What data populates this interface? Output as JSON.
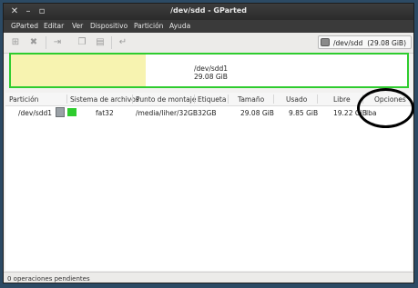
{
  "window": {
    "title": "/dev/sdd - GParted",
    "controls": {
      "close_icon": "close-icon",
      "minimize_icon": "minimize-icon",
      "maximize_icon": "maximize-icon"
    }
  },
  "menu": [
    "GParted",
    "Editar",
    "Ver",
    "Dispositivo",
    "Partición",
    "Ayuda"
  ],
  "toolbar": {
    "icons": [
      "new-partition-icon",
      "delete-icon",
      "resize-move-icon",
      "copy-icon",
      "paste-icon",
      "undo-icon",
      "apply-icon"
    ],
    "device": {
      "path": "/dev/sdd",
      "size": "(29.08 GiB)",
      "icon": "disk-drive-icon"
    }
  },
  "disk_graph": {
    "partition_name": "/dev/sdd1",
    "partition_size": "29.08 GiB",
    "used_fraction": 0.34,
    "border_color": "#2ecc2e",
    "used_color": "#f7f3b0"
  },
  "table": {
    "headers": [
      "Partición",
      "Sistema de archivos",
      "Punto de montaje",
      "Etiqueta",
      "Tamaño",
      "Usado",
      "Libre",
      "Opciones"
    ],
    "rows": [
      {
        "partition": "/dev/sdd1",
        "filesystem": "fat32",
        "fs_color": "#2ecc2e",
        "mountpoint": "/media/liher/32GB",
        "label": "32GB",
        "size": "29.08 GiB",
        "used": "9.85 GiB",
        "free": "19.22 GiB",
        "flags": "lba"
      }
    ]
  },
  "status": {
    "pending": "0 operaciones pendientes"
  }
}
